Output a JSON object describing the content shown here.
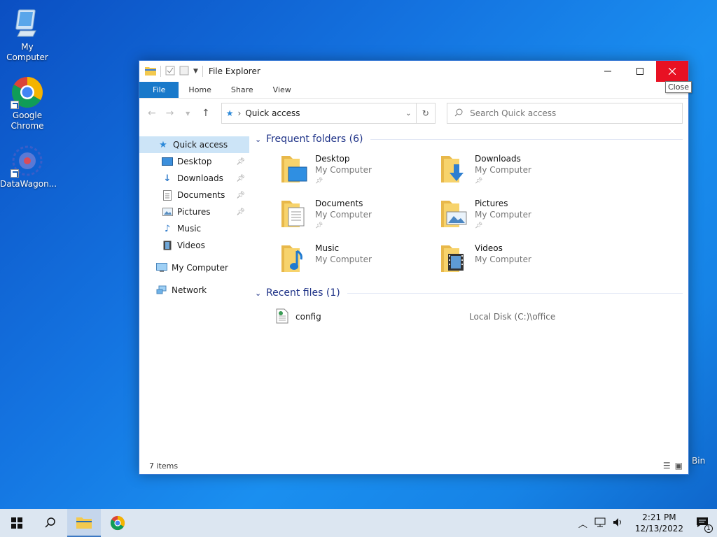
{
  "desktop": {
    "icons": [
      {
        "label": "My Computer",
        "icon": "monitor-icon"
      },
      {
        "label": "Google Chrome",
        "icon": "chrome-icon"
      },
      {
        "label": "DataWagon...",
        "icon": "datawagon-icon"
      }
    ],
    "recycle_bin_label": "Bin"
  },
  "window": {
    "title": "File Explorer",
    "tooltip": "Close",
    "ribbon_tabs": [
      "File",
      "Home",
      "Share",
      "View"
    ],
    "address": "Quick access",
    "search_placeholder": "Search Quick access"
  },
  "nav_pane": {
    "items": [
      {
        "label": "Quick access",
        "icon": "star-icon",
        "pinned": false,
        "selected": true
      },
      {
        "label": "Desktop",
        "icon": "desktop-icon",
        "pinned": true
      },
      {
        "label": "Downloads",
        "icon": "download-icon",
        "pinned": true
      },
      {
        "label": "Documents",
        "icon": "document-icon",
        "pinned": true
      },
      {
        "label": "Pictures",
        "icon": "picture-icon",
        "pinned": true
      },
      {
        "label": "Music",
        "icon": "music-icon",
        "pinned": false
      },
      {
        "label": "Videos",
        "icon": "video-icon",
        "pinned": false
      },
      {
        "label": "My Computer",
        "icon": "computer-icon"
      },
      {
        "label": "Network",
        "icon": "network-icon"
      }
    ]
  },
  "content": {
    "frequent_header": "Frequent folders (6)",
    "folders": [
      {
        "name": "Desktop",
        "location": "My Computer",
        "pinned": true
      },
      {
        "name": "Downloads",
        "location": "My Computer",
        "pinned": true
      },
      {
        "name": "Documents",
        "location": "My Computer",
        "pinned": true
      },
      {
        "name": "Pictures",
        "location": "My Computer",
        "pinned": true
      },
      {
        "name": "Music",
        "location": "My Computer",
        "pinned": false
      },
      {
        "name": "Videos",
        "location": "My Computer",
        "pinned": false
      }
    ],
    "recent_header": "Recent files (1)",
    "recent_files": [
      {
        "name": "config",
        "path": "Local Disk (C:)\\office"
      }
    ]
  },
  "status": {
    "items_count": "7 items"
  },
  "taskbar": {
    "time": "2:21 PM",
    "date": "12/13/2022",
    "notification_count": "1"
  }
}
